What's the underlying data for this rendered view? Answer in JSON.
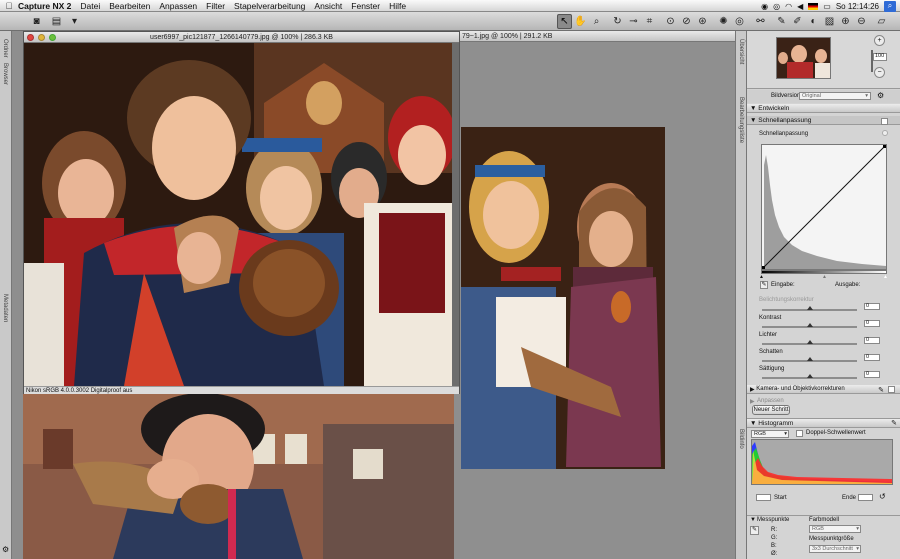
{
  "menubar": {
    "app": "Capture NX 2",
    "items": [
      "Datei",
      "Bearbeiten",
      "Anpassen",
      "Filter",
      "Stapelverarbeitung",
      "Ansicht",
      "Fenster",
      "Hilfe"
    ],
    "clock": "So 12:14:26"
  },
  "left_strip": {
    "labels": [
      "Ordner",
      "Browser",
      "Metadaten"
    ]
  },
  "window_main": {
    "title": "user6997_pic121877_1266140779.jpg @ 100% | 286.3 KB",
    "status": "Nikon sRGB 4.0.0.3002  Digitalproof aus"
  },
  "window_back": {
    "title": "79~1.jpg @ 100% | 291.2 KB"
  },
  "right_strip": {
    "labels": [
      "Übersicht",
      "Bearbeitungsliste",
      "Bildinfo"
    ]
  },
  "overview": {
    "zoom": "100"
  },
  "edit_list": {
    "version_label": "Bildversion",
    "version_value": "Original",
    "develop": "Entwickeln",
    "quick_fix": "Schnellanpassung",
    "quick_fix_sub": "Schnellanpassung",
    "input_label": "Eingabe:",
    "output_label": "Ausgabe:",
    "sliders": [
      {
        "label": "Belichtungskorrektur",
        "value": "0",
        "level": 0.5
      },
      {
        "label": "Kontrast",
        "value": "0",
        "level": 0.5
      },
      {
        "label": "Lichter",
        "value": "0",
        "level": 0.5
      },
      {
        "label": "Schatten",
        "value": "0",
        "level": 0.5
      },
      {
        "label": "Sättigung",
        "value": "0",
        "level": 0.5
      }
    ],
    "camera_corrections": "Kamera- und Objektivkorrekturen",
    "adjust": "Anpassen",
    "new_step": "Neuer Schritt"
  },
  "histogram": {
    "title": "Histogramm",
    "channel": "RGB",
    "double_threshold": "Doppel-Schwellenwert",
    "start_label": "Start",
    "end_label": "Ende",
    "colors": {
      "red": "#ff2a2a",
      "green": "#22cc33",
      "blue": "#2f3cff"
    }
  },
  "measure": {
    "title": "Messpunkte",
    "r": "R:",
    "g": "G:",
    "b": "B:",
    "o": "Ø:",
    "color_model_label": "Farbmodell",
    "color_model_value": "RGB",
    "sample_size_label": "Messpunktgröße",
    "sample_size_value": "3x3 Durchschnitt"
  }
}
